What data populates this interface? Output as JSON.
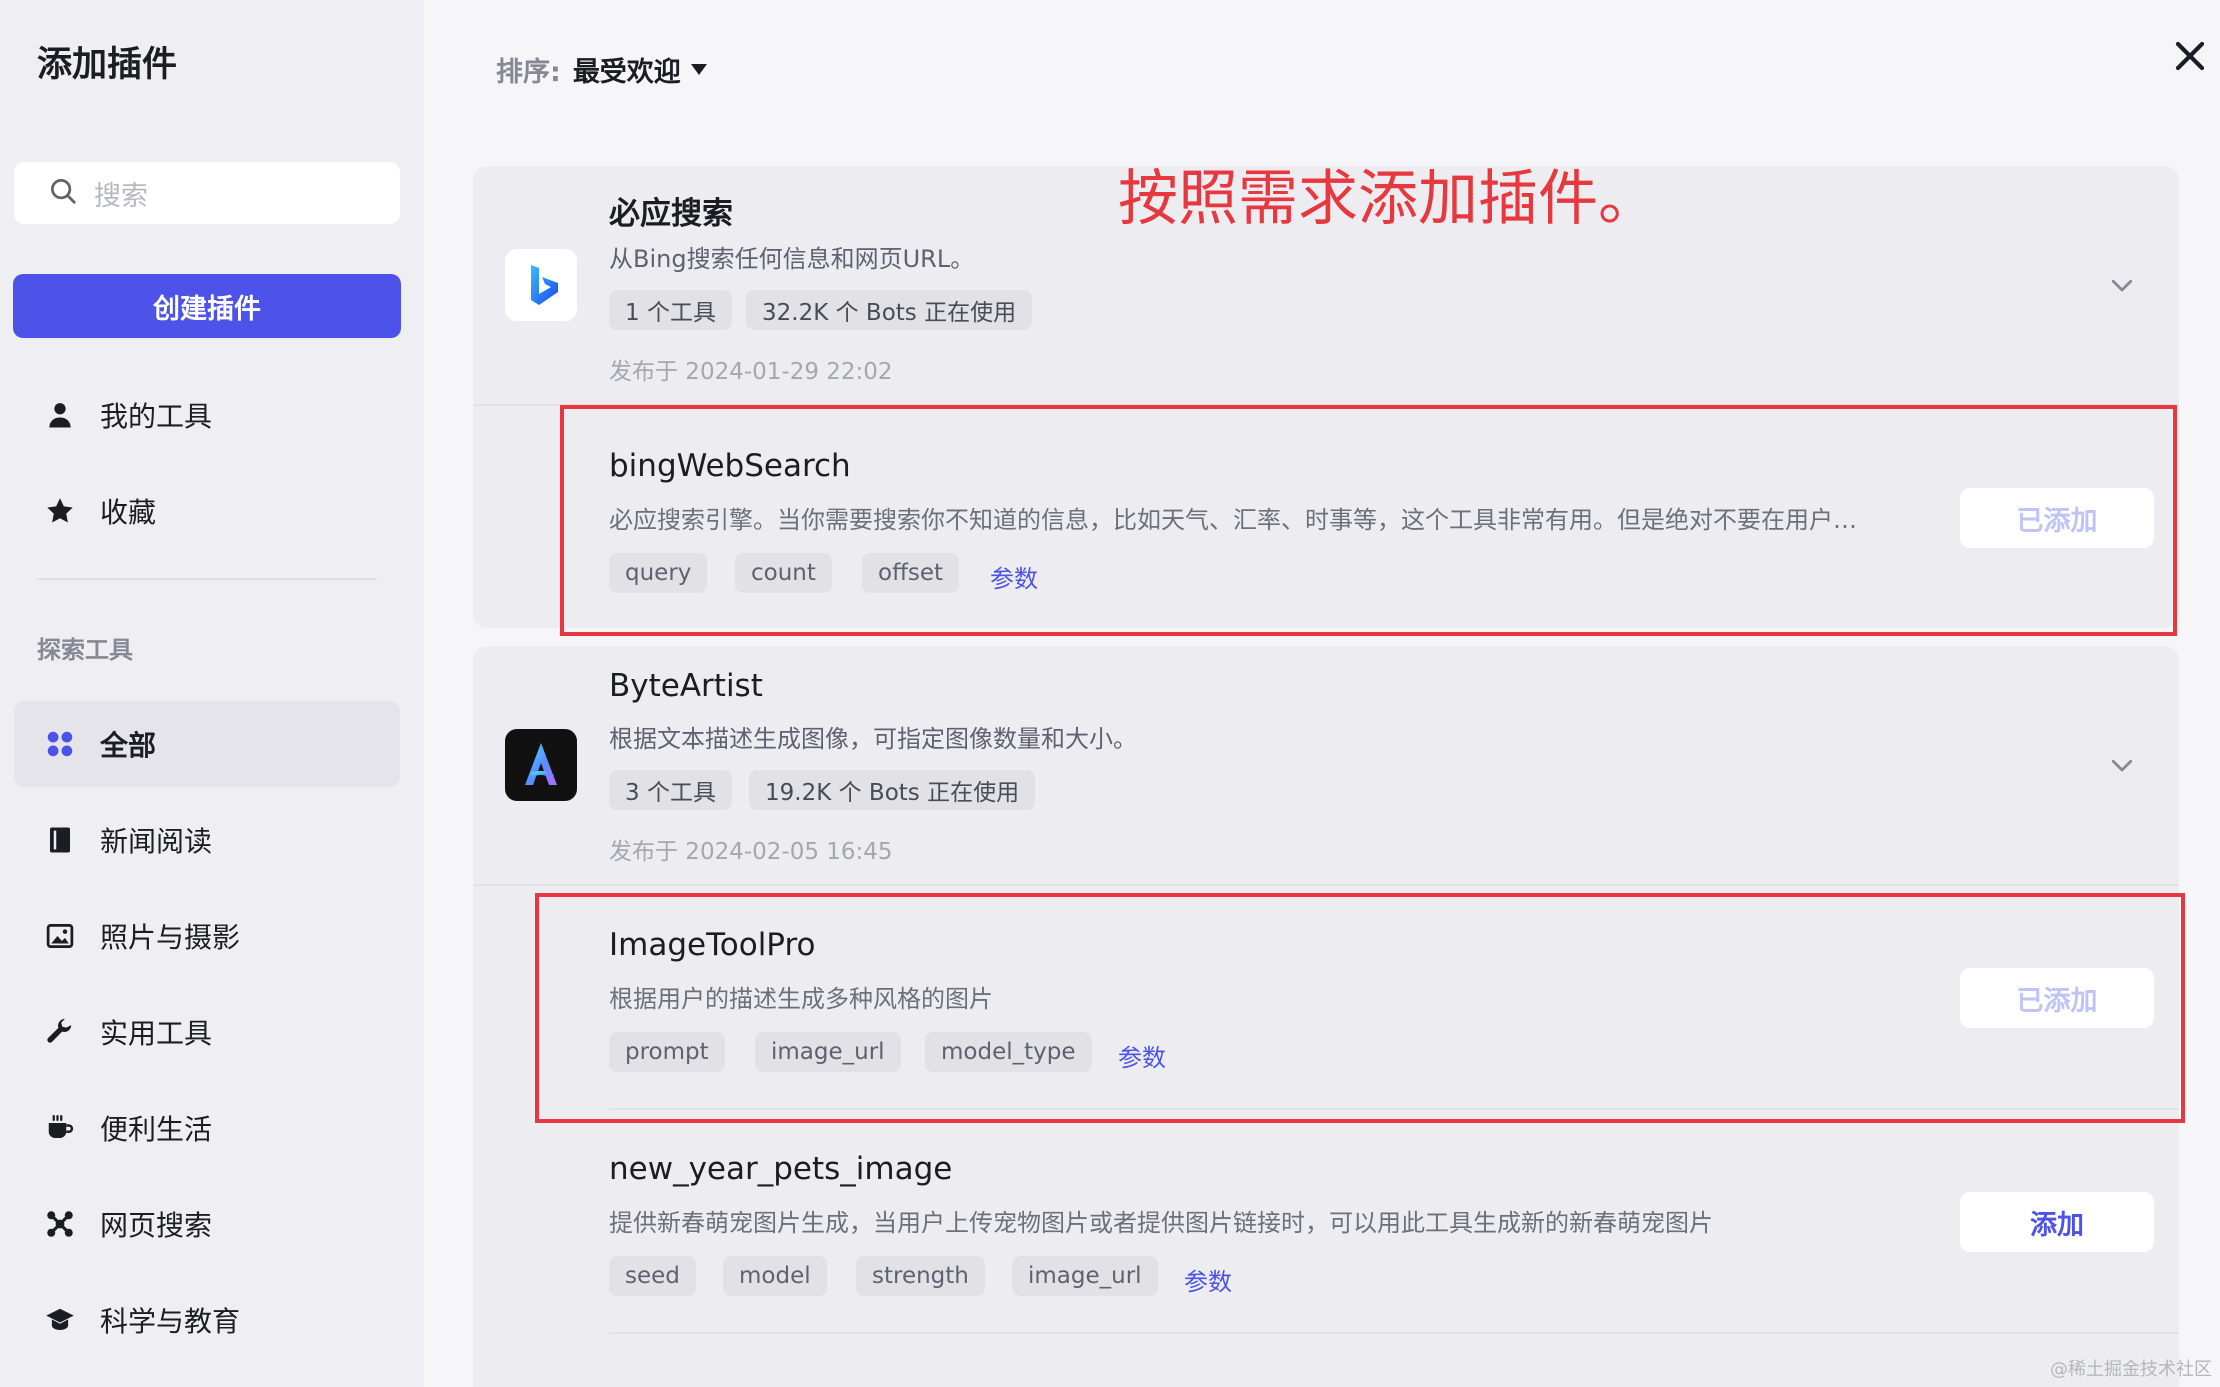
{
  "sidebar": {
    "title": "添加插件",
    "search_placeholder": "搜索",
    "create_button": "创建插件",
    "my_items": [
      {
        "label": "我的工具",
        "icon": "person-icon"
      },
      {
        "label": "收藏",
        "icon": "star-icon"
      }
    ],
    "explore_label": "探索工具",
    "categories": [
      {
        "label": "全部",
        "icon": "grid-icon",
        "active": true
      },
      {
        "label": "新闻阅读",
        "icon": "book-icon"
      },
      {
        "label": "照片与摄影",
        "icon": "image-icon"
      },
      {
        "label": "实用工具",
        "icon": "wrench-icon"
      },
      {
        "label": "便利生活",
        "icon": "cup-icon"
      },
      {
        "label": "网页搜索",
        "icon": "network-icon"
      },
      {
        "label": "科学与教育",
        "icon": "graduation-cap-icon"
      }
    ]
  },
  "sort": {
    "label": "排序:",
    "value": "最受欢迎"
  },
  "annotation": "按照需求添加插件。",
  "plugins": [
    {
      "name": "必应搜索",
      "description": "从Bing搜索任何信息和网页URL。",
      "tools_count": "1 个工具",
      "usage": "32.2K 个 Bots 正在使用",
      "published": "发布于 2024-01-29 22:02",
      "tools": [
        {
          "name": "bingWebSearch",
          "description": "必应搜索引擎。当你需要搜索你不知道的信息，比如天气、汇率、时事等，这个工具非常有用。但是绝对不要在用户想...",
          "params": [
            "query",
            "count",
            "offset"
          ],
          "params_link": "参数",
          "button": "已添加"
        }
      ]
    },
    {
      "name": "ByteArtist",
      "description": "根据文本描述生成图像，可指定图像数量和大小。",
      "tools_count": "3 个工具",
      "usage": "19.2K 个 Bots 正在使用",
      "published": "发布于 2024-02-05 16:45",
      "tools": [
        {
          "name": "ImageToolPro",
          "description": "根据用户的描述生成多种风格的图片",
          "params": [
            "prompt",
            "image_url",
            "model_type"
          ],
          "params_link": "参数",
          "button": "已添加"
        },
        {
          "name": "new_year_pets_image",
          "description": "提供新春萌宠图片生成，当用户上传宠物图片或者提供图片链接时，可以用此工具生成新的新春萌宠图片",
          "params": [
            "seed",
            "model",
            "strength",
            "image_url"
          ],
          "params_link": "参数",
          "button": "添加"
        }
      ]
    }
  ],
  "watermark": "@稀土掘金技术社区",
  "colors": {
    "accent": "#4d53e8",
    "highlight": "#e6383e"
  }
}
